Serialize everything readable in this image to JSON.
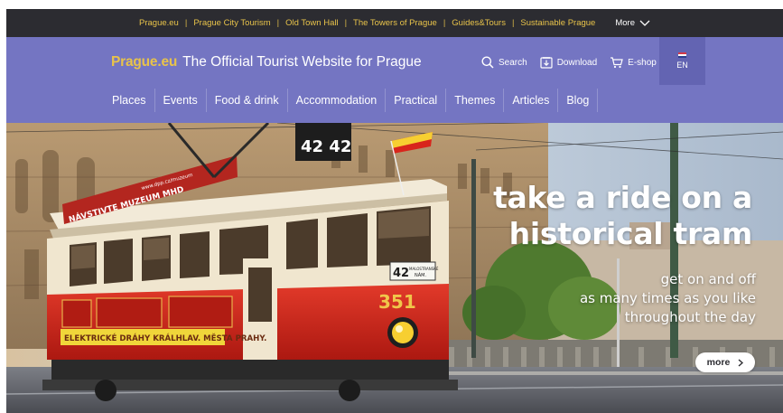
{
  "topbar": {
    "links": [
      "Prague.eu",
      "Prague City Tourism",
      "Old Town Hall",
      "The Towers of Prague",
      "Guides&Tours",
      "Sustainable Prague"
    ],
    "separator": "|",
    "more_label": "More"
  },
  "header": {
    "logo": "Prague.eu",
    "tagline": "The Official Tourist Website for Prague",
    "tools": {
      "search_label": "Search",
      "download_label": "Download",
      "eshop_label": "E-shop"
    },
    "language": "EN",
    "nav": [
      "Places",
      "Events",
      "Food & drink",
      "Accommodation",
      "Practical",
      "Themes",
      "Articles",
      "Blog"
    ]
  },
  "hero": {
    "headline_line1": "take a ride on a",
    "headline_line2": "historical tram",
    "sub_line1": "get on and off",
    "sub_line2": "as many times as you like",
    "sub_line3": "throughout the day",
    "more_label": "more",
    "tram_number": "42 42",
    "tram_sign": "NÁVSTIVTE MUZEUM MHD",
    "tram_sign_small": "www.dpp.cz/muzeum",
    "tram_fleet_number": "351",
    "tram_route": "42",
    "tram_destination_1": "MALOSTRANSKÉ",
    "tram_destination_2": "NÁM.",
    "tram_banner": "ELEKTRICKÉ DRÁHY KRÁLHLAV. MĚSTA PRAHY."
  },
  "colors": {
    "topbar_bg": "#2c2c31",
    "topbar_link": "#e8c34a",
    "header_bg": "#7475c2",
    "lang_bg": "#6364b2",
    "logo": "#e8c34a",
    "tram_red": "#d8251c",
    "tram_cream": "#f2ead8"
  }
}
